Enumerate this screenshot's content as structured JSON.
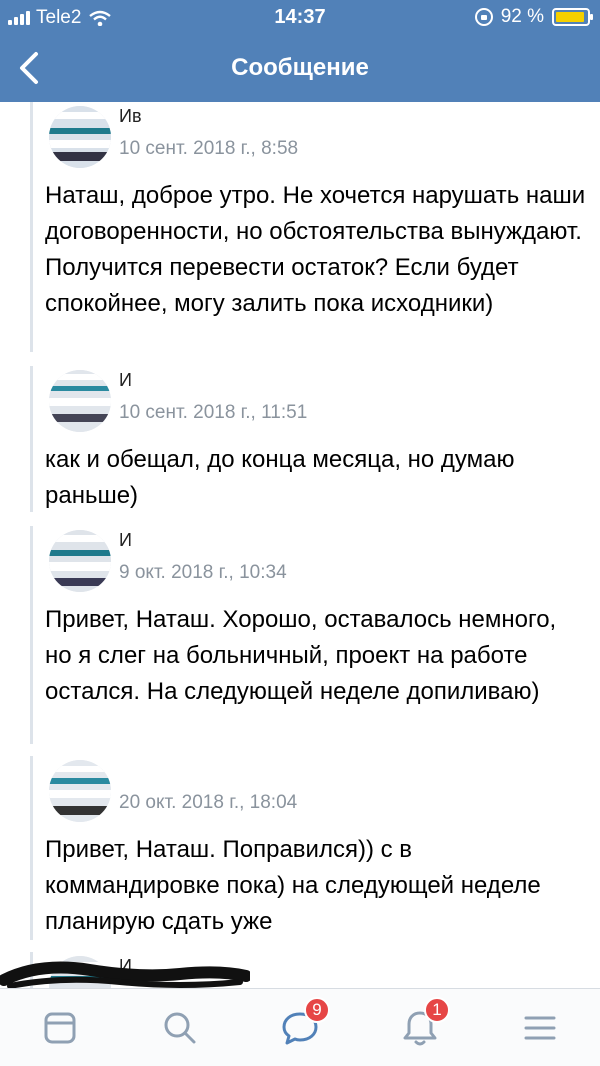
{
  "status_bar": {
    "carrier": "Tele2",
    "time": "14:37",
    "battery": "92 %",
    "battery_level": 0.92
  },
  "nav": {
    "title": "Сообщение"
  },
  "messages": [
    {
      "author": "Ив",
      "date": "10 сент. 2018 г., 8:58",
      "text": "Наташ, доброе утро. Не хочется нарушать наши договоренности, но обстоятельства вынуждают. Получится перевести остаток? Если будет спокойнее, могу залить пока исходники)"
    },
    {
      "author": "И",
      "date": "10 сент. 2018 г., 11:51",
      "text": "как и обещал, до конца месяца, но думаю раньше)"
    },
    {
      "author": "И",
      "date": "9 окт. 2018 г., 10:34",
      "text": "Привет, Наташ. Хорошо, оставалось немного, но я слег на больничный, проект на работе остался. На следующей неделе допиливаю)"
    },
    {
      "author": "",
      "date": "20 окт. 2018 г., 18:04",
      "text": "Привет, Наташ. Поправился)) с в коммандировке пока) на следующей неделе планирую сдать уже"
    },
    {
      "author": "И",
      "date": "",
      "text": ""
    }
  ],
  "tabbar": {
    "tabs": [
      {
        "icon": "news-feed-icon"
      },
      {
        "icon": "search-icon"
      },
      {
        "icon": "messages-icon",
        "badge": "9"
      },
      {
        "icon": "notifications-bell-icon",
        "badge": "1"
      },
      {
        "icon": "menu-icon"
      }
    ]
  },
  "colors": {
    "header": "#5181b8",
    "badge": "#e64646",
    "tab_icon": "#8fa0b3",
    "messages_tab_active": "#5181b8"
  }
}
